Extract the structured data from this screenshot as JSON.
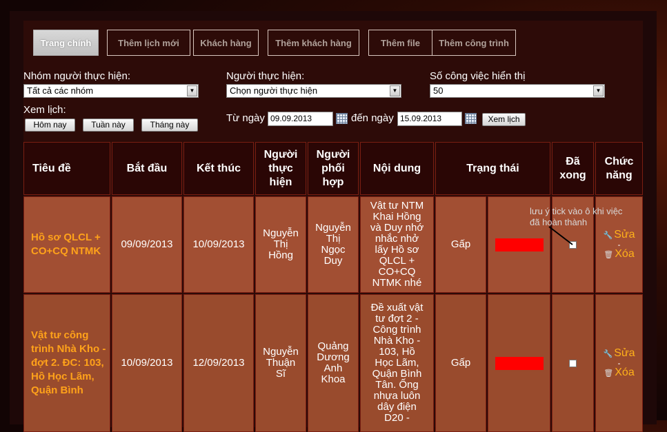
{
  "tabs": [
    {
      "label": "Trang chính",
      "active": true
    },
    {
      "label": "Thêm lịch mới"
    },
    {
      "label": "Khách hàng"
    },
    {
      "label": "Thêm khách hàng"
    },
    {
      "label": "Thêm file"
    },
    {
      "label": "Thêm công trình"
    }
  ],
  "filters": {
    "group_label": "Nhóm người thực hiện:",
    "group_value": "Tất cả các nhóm",
    "person_label": "Người thực hiện:",
    "person_value": "Chọn người thực hiện",
    "count_label": "Số công việc hiển thị",
    "count_value": "50",
    "view_label": "Xem lịch:",
    "today_button": "Hôm nay",
    "week_button": "Tuần này",
    "month_button": "Tháng này",
    "from_label": "Từ ngày",
    "from_value": "09.09.2013",
    "to_label": "đến ngày",
    "to_value": "15.09.2013",
    "view_button": "Xem lịch"
  },
  "table": {
    "headers": [
      "Tiêu đề",
      "Bắt đầu",
      "Kết thúc",
      "Người thực hiện",
      "Người phối hợp",
      "Nội dung",
      "Trạng thái",
      "Đã xong",
      "Chức năng"
    ],
    "rows": [
      {
        "title": "Hồ sơ QLCL + CO+CQ NTMK",
        "start": "09/09/2013",
        "end": "10/09/2013",
        "assignee": "Nguyễn Thị Hồng",
        "collaborator": "Nguyễn Thị Ngọc Duy",
        "content": "Vật tư NTM Khai Hồng và Duy nhớ nhắc nhở lấy Hồ sơ QLCL + CO+CQ NTMK nhé",
        "status": "Gấp",
        "status_color": "#ff0000",
        "done": false,
        "edit": "Sửa",
        "delete": "Xóa"
      },
      {
        "title": "Vật tư công trình Nhà Kho - đợt 2. ĐC: 103, Hồ Học Lãm, Quận Bình",
        "start": "10/09/2013",
        "end": "12/09/2013",
        "assignee": "Nguyễn Thuận Sĩ",
        "collaborator": "Quảng Dương Anh Khoa",
        "content": "Đề xuất vật tư đợt 2 - Công trình Nhà Kho - 103, Hồ Học Lãm, Quận Bình Tân. Ống nhựa luôn dây điện D20 -",
        "status": "Gấp",
        "status_color": "#ff0000",
        "done": false,
        "edit": "Sửa",
        "delete": "Xóa"
      }
    ]
  },
  "annotation": {
    "text": "lưu ý tick vào ô khi việc đã hoàn thành"
  },
  "colors": {
    "accent_orange": "#ffa21a",
    "row_bg": "#a24f33",
    "header_bg": "#2a0605",
    "status_red": "#ff0000"
  }
}
